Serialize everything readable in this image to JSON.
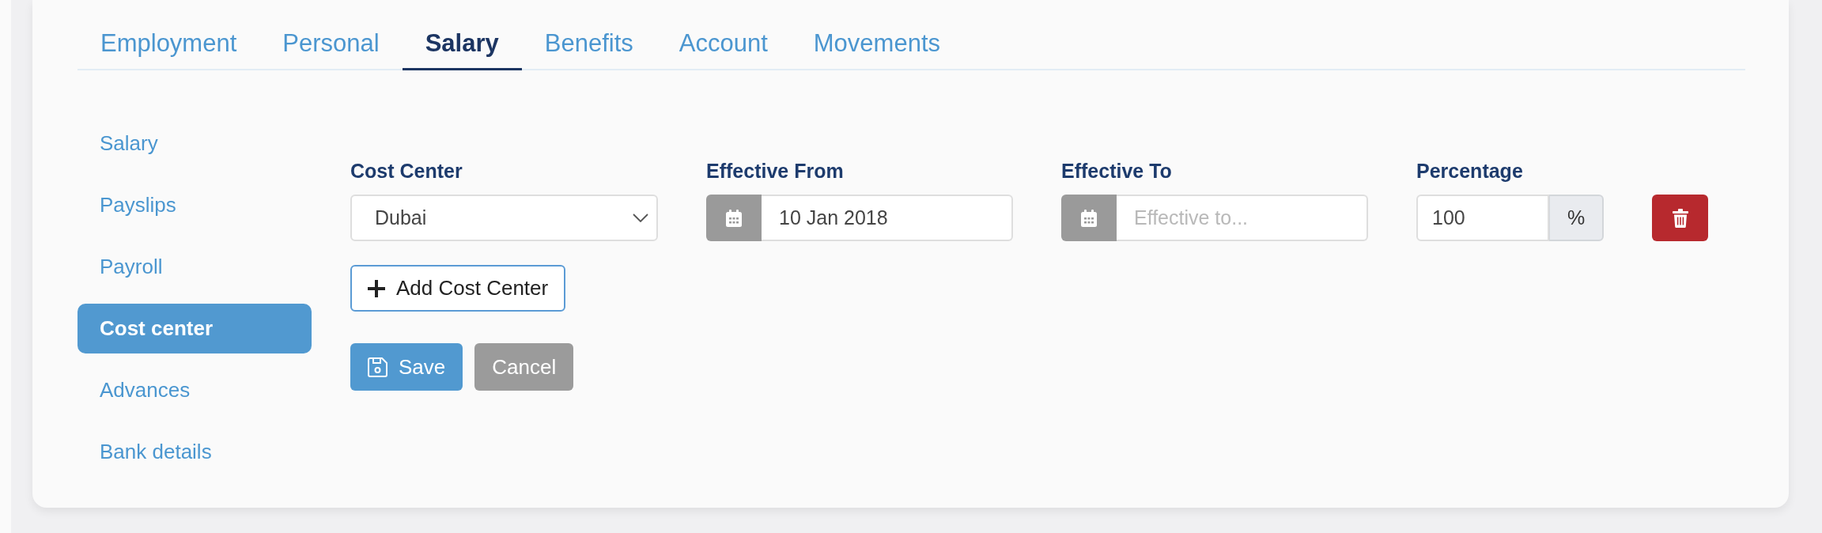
{
  "tabs": [
    {
      "label": "Employment",
      "selected": false
    },
    {
      "label": "Personal",
      "selected": false
    },
    {
      "label": "Salary",
      "selected": true
    },
    {
      "label": "Benefits",
      "selected": false
    },
    {
      "label": "Account",
      "selected": false
    },
    {
      "label": "Movements",
      "selected": false
    }
  ],
  "sidebar": {
    "items": [
      {
        "label": "Salary",
        "selected": false
      },
      {
        "label": "Payslips",
        "selected": false
      },
      {
        "label": "Payroll",
        "selected": false
      },
      {
        "label": "Cost center",
        "selected": true
      },
      {
        "label": "Advances",
        "selected": false
      },
      {
        "label": "Bank details",
        "selected": false
      }
    ]
  },
  "form": {
    "labels": [
      "Cost Center",
      "Effective From",
      "Effective To",
      "Percentage"
    ],
    "rows": [
      {
        "fields": [
          {
            "kind": "select",
            "value": "Dubai"
          },
          {
            "kind": "date",
            "value": "10 Jan 2018"
          },
          {
            "kind": "date",
            "placeholder": "Effective to..."
          },
          {
            "kind": "percent",
            "value": "100",
            "suffix": "%"
          }
        ]
      }
    ],
    "add_button": "Add Cost Center",
    "actions": [
      {
        "kind": "save",
        "label": "Save"
      },
      {
        "kind": "cancel",
        "label": "Cancel"
      }
    ]
  }
}
